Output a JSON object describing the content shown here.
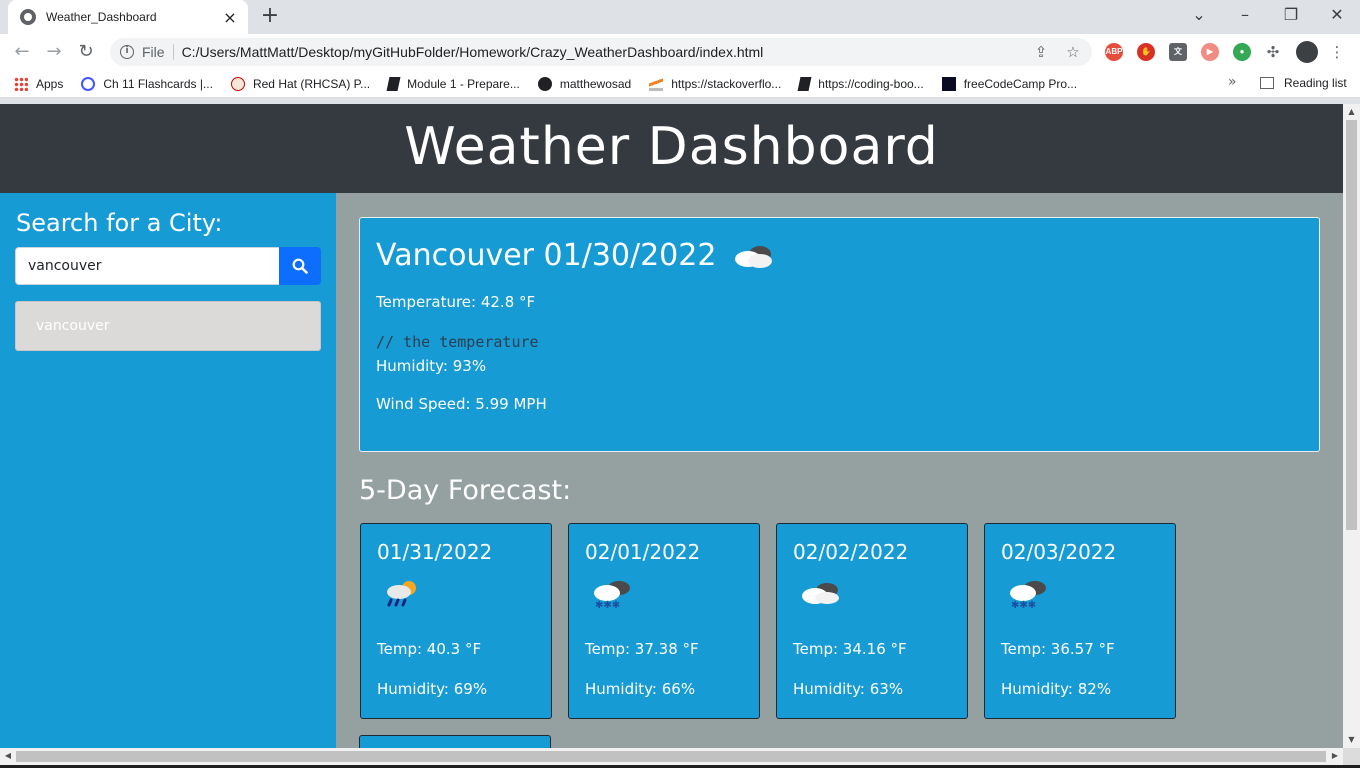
{
  "browser": {
    "tab_title": "Weather_Dashboard",
    "scheme": "File",
    "url": "C:/Users/MattMatt/Desktop/myGitHubFolder/Homework/Crazy_WeatherDashboard/index.html",
    "bookmarks": [
      {
        "label": "Apps",
        "icon": "apps-grid-icon",
        "color": "#ea4335"
      },
      {
        "label": "Ch 11 Flashcards |...",
        "icon": "quizlet-icon",
        "color": "#4255ff"
      },
      {
        "label": "Red Hat (RHCSA) P...",
        "icon": "redhat-icon",
        "color": "#cc0000"
      },
      {
        "label": "Module 1 - Prepare...",
        "icon": "bookmark-doc-icon",
        "color": "#202124"
      },
      {
        "label": "matthewosad",
        "icon": "github-icon",
        "color": "#202124"
      },
      {
        "label": "https://stackoverflo...",
        "icon": "stackoverflow-icon",
        "color": "#f48024"
      },
      {
        "label": "https://coding-boo...",
        "icon": "bookmark-doc-icon",
        "color": "#202124"
      },
      {
        "label": "freeCodeCamp Pro...",
        "icon": "freecodecamp-icon",
        "color": "#0a0a23"
      }
    ],
    "bookmarks_more": "»",
    "reading_list": "Reading list",
    "extensions": [
      {
        "label": "ABP",
        "color": "#e74c3c"
      },
      {
        "label": "",
        "color": "#d93025"
      },
      {
        "label": "",
        "color": "#5f6368"
      },
      {
        "label": "",
        "color": "#f28b82"
      },
      {
        "label": "",
        "color": "#34a853"
      }
    ]
  },
  "page": {
    "title": "Weather Dashboard",
    "search": {
      "label": "Search for a City:",
      "value": "vancouver"
    },
    "history": [
      "vancouver"
    ],
    "current": {
      "city_date": "Vancouver 01/30/2022",
      "icon": "cloud-icon",
      "temperature": "Temperature: 42.8 °F",
      "comment": "// the temperature",
      "humidity": "Humidity: 93%",
      "wind": "Wind Speed: 5.99 MPH"
    },
    "forecast_title": "5-Day Forecast:",
    "forecast": [
      {
        "date": "01/31/2022",
        "icon": "sun-rain-icon",
        "temp": "Temp: 40.3 °F",
        "humidity": "Humidity: 69%"
      },
      {
        "date": "02/01/2022",
        "icon": "snow-cloud-icon",
        "temp": "Temp: 37.38 °F",
        "humidity": "Humidity: 66%"
      },
      {
        "date": "02/02/2022",
        "icon": "cloud-icon",
        "temp": "Temp: 34.16 °F",
        "humidity": "Humidity: 63%"
      },
      {
        "date": "02/03/2022",
        "icon": "snow-cloud-icon",
        "temp": "Temp: 36.57 °F",
        "humidity": "Humidity: 82%"
      }
    ]
  }
}
